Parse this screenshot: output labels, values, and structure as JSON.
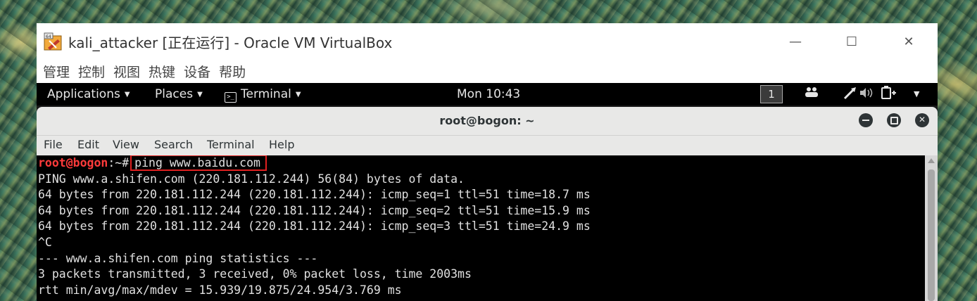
{
  "vbox": {
    "title": "kali_attacker [正在运行] - Oracle VM VirtualBox",
    "menu": [
      "管理",
      "控制",
      "视图",
      "热键",
      "设备",
      "帮助"
    ],
    "controls": {
      "minimize": "—",
      "maximize": "☐",
      "close": "✕"
    }
  },
  "guest_topbar": {
    "applications": "Applications",
    "places": "Places",
    "terminal": "Terminal",
    "clock": "Mon 10:43",
    "workspace": "1"
  },
  "terminal": {
    "title": "root@bogon: ~",
    "menu": [
      "File",
      "Edit",
      "View",
      "Search",
      "Terminal",
      "Help"
    ],
    "prompt_user": "root@bogon",
    "prompt_path": ":~#",
    "command": "ping www.baidu.com",
    "output": [
      "PING www.a.shifen.com (220.181.112.244) 56(84) bytes of data.",
      "64 bytes from 220.181.112.244 (220.181.112.244): icmp_seq=1 ttl=51 time=18.7 ms",
      "64 bytes from 220.181.112.244 (220.181.112.244): icmp_seq=2 ttl=51 time=15.9 ms",
      "64 bytes from 220.181.112.244 (220.181.112.244): icmp_seq=3 ttl=51 time=24.9 ms",
      "^C",
      "--- www.a.shifen.com ping statistics ---",
      "3 packets transmitted, 3 received, 0% packet loss, time 2003ms",
      "rtt min/avg/max/mdev = 15.939/19.875/24.954/3.769 ms"
    ]
  },
  "colors": {
    "prompt_user": "#ff3b3b",
    "highlight_box": "#e02020",
    "terminal_bg": "#000000",
    "topbar_bg": "#000000"
  }
}
